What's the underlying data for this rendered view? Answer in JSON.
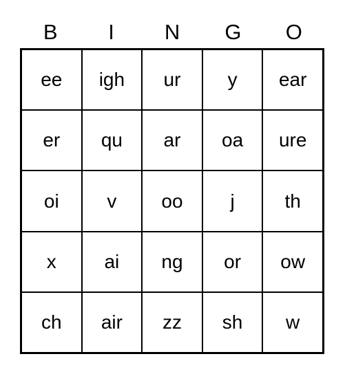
{
  "card": {
    "title": "BINGO",
    "headers": [
      "B",
      "I",
      "N",
      "G",
      "O"
    ],
    "rows": [
      [
        "ee",
        "igh",
        "ur",
        "y",
        "ear"
      ],
      [
        "er",
        "qu",
        "ar",
        "oa",
        "ure"
      ],
      [
        "oi",
        "v",
        "oo",
        "j",
        "th"
      ],
      [
        "x",
        "ai",
        "ng",
        "or",
        "ow"
      ],
      [
        "ch",
        "air",
        "zz",
        "sh",
        "w"
      ]
    ],
    "colors": {
      "background": "#ffffff",
      "text": "#000000",
      "grid_line": "#000000"
    }
  }
}
